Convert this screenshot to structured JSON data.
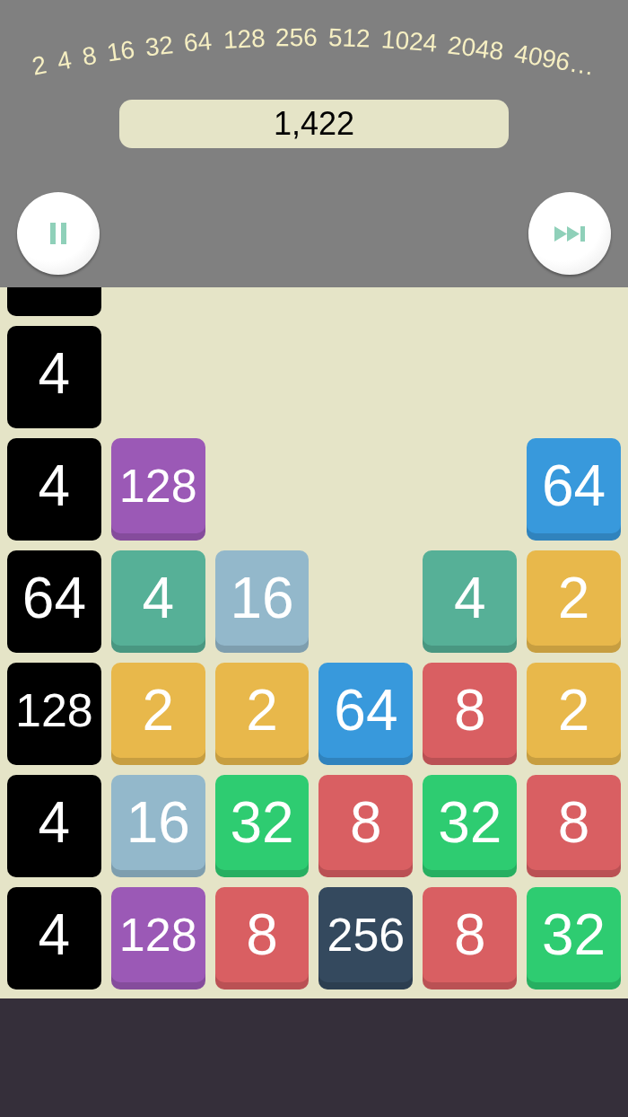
{
  "sequence": [
    "2",
    "4",
    "8",
    "16",
    "32",
    "64",
    "128",
    "256",
    "512",
    "1024",
    "2048",
    "4096…"
  ],
  "score": "1,422",
  "controls": [
    {
      "kind": "pause"
    },
    {
      "kind": "skip"
    }
  ],
  "board": {
    "columns": [
      {
        "tiles": [
          {
            "color": "#000000"
          },
          {
            "value": "4",
            "color": "#000000"
          },
          {
            "value": "4",
            "color": "#000000"
          },
          {
            "value": "64",
            "color": "#000000"
          },
          {
            "value": "128",
            "color": "#000000"
          },
          {
            "value": "4",
            "color": "#000000"
          },
          {
            "value": "4",
            "color": "#000000"
          }
        ]
      },
      {
        "tiles": [
          {
            "value": "128",
            "color": "#9b59b6"
          },
          {
            "value": "4",
            "color": "#56b097"
          },
          {
            "value": "2",
            "color": "#e8b84b"
          },
          {
            "value": "16",
            "color": "#93b8cb"
          },
          {
            "value": "128",
            "color": "#9b59b6"
          }
        ]
      },
      {
        "tiles": [
          {
            "value": "16",
            "color": "#93b8cb"
          },
          {
            "value": "2",
            "color": "#e8b84b"
          },
          {
            "value": "32",
            "color": "#2ecc71"
          },
          {
            "value": "8",
            "color": "#d95f62"
          }
        ]
      },
      {
        "tiles": [
          {
            "value": "64",
            "color": "#3899dc"
          },
          {
            "value": "8",
            "color": "#d95f62"
          },
          {
            "value": "256",
            "color": "#34495e"
          }
        ]
      },
      {
        "tiles": [
          {
            "value": "4",
            "color": "#56b097"
          },
          {
            "value": "8",
            "color": "#d95f62"
          },
          {
            "value": "32",
            "color": "#2ecc71"
          },
          {
            "value": "8",
            "color": "#d95f62"
          }
        ]
      },
      {
        "tiles": [
          {
            "value": "64",
            "color": "#3899dc"
          },
          {
            "value": "2",
            "color": "#e8b84b"
          },
          {
            "value": "2",
            "color": "#e8b84b"
          },
          {
            "value": "8",
            "color": "#d95f62"
          },
          {
            "value": "32",
            "color": "#2ecc71"
          }
        ]
      }
    ]
  }
}
